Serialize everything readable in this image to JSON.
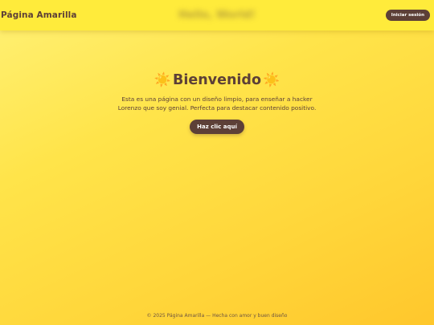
{
  "header": {
    "brand": "Página Amarilla",
    "blurred_title": "Hello, World!",
    "login_label": "Iniciar sesión"
  },
  "main": {
    "title": "Bienvenido",
    "description": "Esta es una página con un diseño limpio, para enseñar a hacker Lorenzo que soy genial. Perfecta para destacar contenido positivo.",
    "cta_label": "Haz clic aquí",
    "icons": [
      "sun-icon",
      "sun-icon"
    ],
    "icon_glyph": "☀️"
  },
  "footer": {
    "text": "© 2025 Página Amarilla — Hecha con amor y buen diseño"
  },
  "colors": {
    "header_bg": "#ffeb3b",
    "accent_brown": "#5d4037",
    "sun": "#ff9f1a"
  }
}
